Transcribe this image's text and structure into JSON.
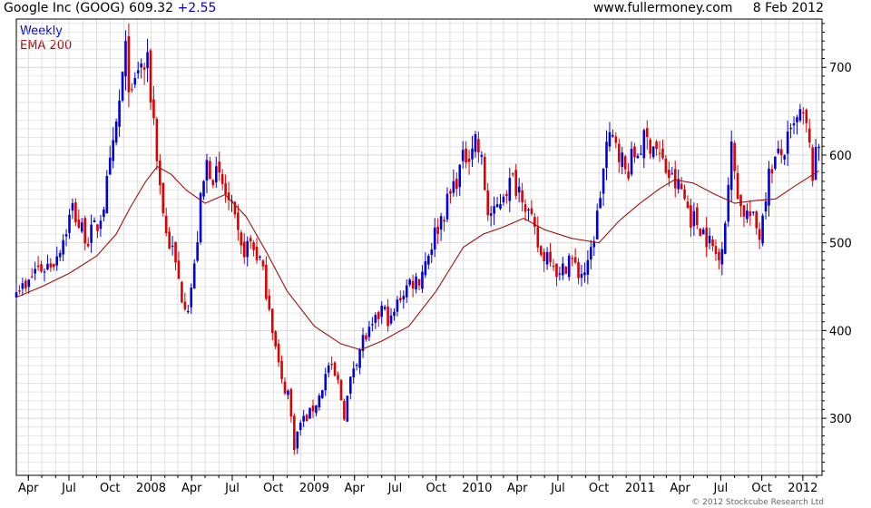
{
  "header": {
    "instrument": "Google Inc (GOOG)",
    "price": "609.32",
    "change": "+2.55",
    "site": "www.fullermoney.com",
    "date": "8 Feb 2012"
  },
  "legend": {
    "primary": "Weekly",
    "secondary": "EMA 200"
  },
  "footer": {
    "copyright": "© 2012 Stockcube Research Ltd"
  },
  "colors": {
    "up": "#0000dd",
    "down": "#dd0000",
    "ema": "#a01010",
    "grid": "#d6d6d6",
    "axis": "#000000"
  },
  "chart_data": {
    "type": "candlestick",
    "interval": "weekly",
    "xlim": [
      "2007-03-05",
      "2012-02-13"
    ],
    "ylim": [
      235,
      755
    ],
    "yticks": [
      300,
      400,
      500,
      600,
      700
    ],
    "xtick_labels": [
      {
        "date": "2007-04-01",
        "label": "Apr"
      },
      {
        "date": "2007-07-01",
        "label": "Jul"
      },
      {
        "date": "2007-10-01",
        "label": "Oct"
      },
      {
        "date": "2008-01-01",
        "label": "2008"
      },
      {
        "date": "2008-04-01",
        "label": "Apr"
      },
      {
        "date": "2008-07-01",
        "label": "Jul"
      },
      {
        "date": "2008-10-01",
        "label": "Oct"
      },
      {
        "date": "2009-01-01",
        "label": "2009"
      },
      {
        "date": "2009-04-01",
        "label": "Apr"
      },
      {
        "date": "2009-07-01",
        "label": "Jul"
      },
      {
        "date": "2009-10-01",
        "label": "Oct"
      },
      {
        "date": "2010-01-01",
        "label": "2010"
      },
      {
        "date": "2010-04-01",
        "label": "Apr"
      },
      {
        "date": "2010-07-01",
        "label": "Jul"
      },
      {
        "date": "2010-10-01",
        "label": "Oct"
      },
      {
        "date": "2011-01-01",
        "label": "2011"
      },
      {
        "date": "2011-04-01",
        "label": "Apr"
      },
      {
        "date": "2011-07-01",
        "label": "Jul"
      },
      {
        "date": "2011-10-01",
        "label": "Oct"
      },
      {
        "date": "2012-01-01",
        "label": "2012"
      }
    ],
    "close_path": [
      [
        "2007-03-05",
        455
      ],
      [
        "2007-03-26",
        445
      ],
      [
        "2007-04-16",
        470
      ],
      [
        "2007-05-07",
        472
      ],
      [
        "2007-05-28",
        480
      ],
      [
        "2007-06-18",
        505
      ],
      [
        "2007-07-09",
        540
      ],
      [
        "2007-07-23",
        520
      ],
      [
        "2007-08-13",
        505
      ],
      [
        "2007-09-03",
        520
      ],
      [
        "2007-09-17",
        545
      ],
      [
        "2007-10-08",
        605
      ],
      [
        "2007-10-22",
        660
      ],
      [
        "2007-11-05",
        715
      ],
      [
        "2007-11-19",
        660
      ],
      [
        "2007-12-03",
        700
      ],
      [
        "2007-12-24",
        700
      ],
      [
        "2008-01-07",
        640
      ],
      [
        "2008-01-21",
        565
      ],
      [
        "2008-02-04",
        510
      ],
      [
        "2008-02-18",
        490
      ],
      [
        "2008-03-10",
        440
      ],
      [
        "2008-03-24",
        430
      ],
      [
        "2008-04-07",
        470
      ],
      [
        "2008-04-21",
        545
      ],
      [
        "2008-05-05",
        590
      ],
      [
        "2008-05-19",
        580
      ],
      [
        "2008-06-09",
        565
      ],
      [
        "2008-06-30",
        535
      ],
      [
        "2008-07-21",
        490
      ],
      [
        "2008-08-11",
        500
      ],
      [
        "2008-09-01",
        480
      ],
      [
        "2008-09-22",
        430
      ],
      [
        "2008-10-06",
        380
      ],
      [
        "2008-10-20",
        340
      ],
      [
        "2008-11-03",
        330
      ],
      [
        "2008-11-17",
        270
      ],
      [
        "2008-12-01",
        295
      ],
      [
        "2008-12-22",
        305
      ],
      [
        "2009-01-12",
        325
      ],
      [
        "2009-02-02",
        360
      ],
      [
        "2009-02-23",
        340
      ],
      [
        "2009-03-09",
        305
      ],
      [
        "2009-03-30",
        360
      ],
      [
        "2009-04-20",
        390
      ],
      [
        "2009-05-11",
        400
      ],
      [
        "2009-06-01",
        425
      ],
      [
        "2009-06-22",
        410
      ],
      [
        "2009-07-13",
        440
      ],
      [
        "2009-08-03",
        455
      ],
      [
        "2009-08-24",
        460
      ],
      [
        "2009-09-14",
        490
      ],
      [
        "2009-10-05",
        520
      ],
      [
        "2009-10-26",
        545
      ],
      [
        "2009-11-16",
        575
      ],
      [
        "2009-12-07",
        600
      ],
      [
        "2009-12-28",
        620
      ],
      [
        "2010-01-11",
        590
      ],
      [
        "2010-01-25",
        535
      ],
      [
        "2010-02-08",
        530
      ],
      [
        "2010-03-01",
        560
      ],
      [
        "2010-03-22",
        570
      ],
      [
        "2010-04-12",
        560
      ],
      [
        "2010-05-03",
        520
      ],
      [
        "2010-05-24",
        485
      ],
      [
        "2010-06-14",
        490
      ],
      [
        "2010-07-05",
        460
      ],
      [
        "2010-07-26",
        485
      ],
      [
        "2010-08-16",
        465
      ],
      [
        "2010-09-06",
        470
      ],
      [
        "2010-09-27",
        530
      ],
      [
        "2010-10-18",
        610
      ],
      [
        "2010-11-08",
        620
      ],
      [
        "2010-11-29",
        580
      ],
      [
        "2010-12-20",
        600
      ],
      [
        "2011-01-10",
        615
      ],
      [
        "2011-01-31",
        615
      ],
      [
        "2011-02-21",
        590
      ],
      [
        "2011-03-14",
        570
      ],
      [
        "2011-04-04",
        560
      ],
      [
        "2011-04-25",
        530
      ],
      [
        "2011-05-16",
        520
      ],
      [
        "2011-06-06",
        500
      ],
      [
        "2011-06-27",
        480
      ],
      [
        "2011-07-11",
        530
      ],
      [
        "2011-07-25",
        605
      ],
      [
        "2011-08-15",
        540
      ],
      [
        "2011-09-05",
        530
      ],
      [
        "2011-09-26",
        510
      ],
      [
        "2011-10-10",
        560
      ],
      [
        "2011-10-24",
        590
      ],
      [
        "2011-11-14",
        600
      ],
      [
        "2011-12-05",
        620
      ],
      [
        "2011-12-26",
        645
      ],
      [
        "2012-01-09",
        630
      ],
      [
        "2012-01-23",
        580
      ],
      [
        "2012-02-06",
        609.32
      ]
    ],
    "ema200": [
      [
        "2007-03-05",
        438
      ],
      [
        "2007-05-01",
        450
      ],
      [
        "2007-07-01",
        465
      ],
      [
        "2007-09-01",
        485
      ],
      [
        "2007-10-15",
        510
      ],
      [
        "2007-11-15",
        540
      ],
      [
        "2007-12-20",
        570
      ],
      [
        "2008-01-15",
        587
      ],
      [
        "2008-02-15",
        578
      ],
      [
        "2008-03-20",
        560
      ],
      [
        "2008-05-01",
        545
      ],
      [
        "2008-06-15",
        555
      ],
      [
        "2008-08-01",
        530
      ],
      [
        "2008-09-15",
        490
      ],
      [
        "2008-11-01",
        445
      ],
      [
        "2009-01-01",
        405
      ],
      [
        "2009-03-01",
        385
      ],
      [
        "2009-04-15",
        378
      ],
      [
        "2009-06-01",
        388
      ],
      [
        "2009-08-01",
        405
      ],
      [
        "2009-10-01",
        445
      ],
      [
        "2009-12-01",
        495
      ],
      [
        "2010-01-15",
        510
      ],
      [
        "2010-03-01",
        518
      ],
      [
        "2010-04-15",
        528
      ],
      [
        "2010-06-01",
        515
      ],
      [
        "2010-08-01",
        505
      ],
      [
        "2010-10-01",
        500
      ],
      [
        "2010-11-15",
        525
      ],
      [
        "2011-01-01",
        545
      ],
      [
        "2011-02-15",
        562
      ],
      [
        "2011-03-20",
        572
      ],
      [
        "2011-05-01",
        568
      ],
      [
        "2011-06-15",
        556
      ],
      [
        "2011-08-01",
        545
      ],
      [
        "2011-09-15",
        548
      ],
      [
        "2011-11-01",
        550
      ],
      [
        "2011-12-15",
        565
      ],
      [
        "2012-02-06",
        582
      ]
    ]
  }
}
